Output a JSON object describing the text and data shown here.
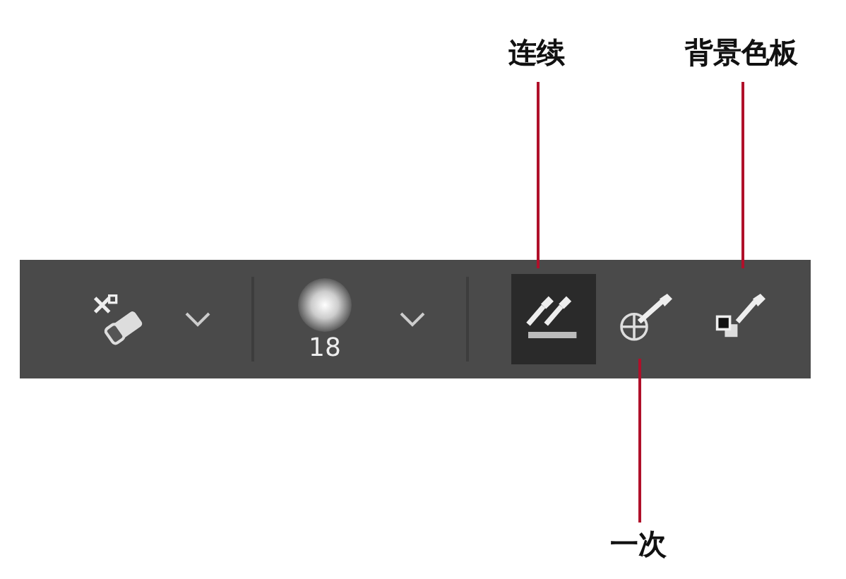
{
  "toolbar": {
    "brush_size": "18",
    "sampling": [
      {
        "kind": "continuous",
        "selected": true
      },
      {
        "kind": "once",
        "selected": false
      },
      {
        "kind": "background",
        "selected": false
      }
    ]
  },
  "annotations": [
    {
      "label": "连续"
    },
    {
      "label": "背景色板"
    },
    {
      "label": "一次"
    }
  ]
}
